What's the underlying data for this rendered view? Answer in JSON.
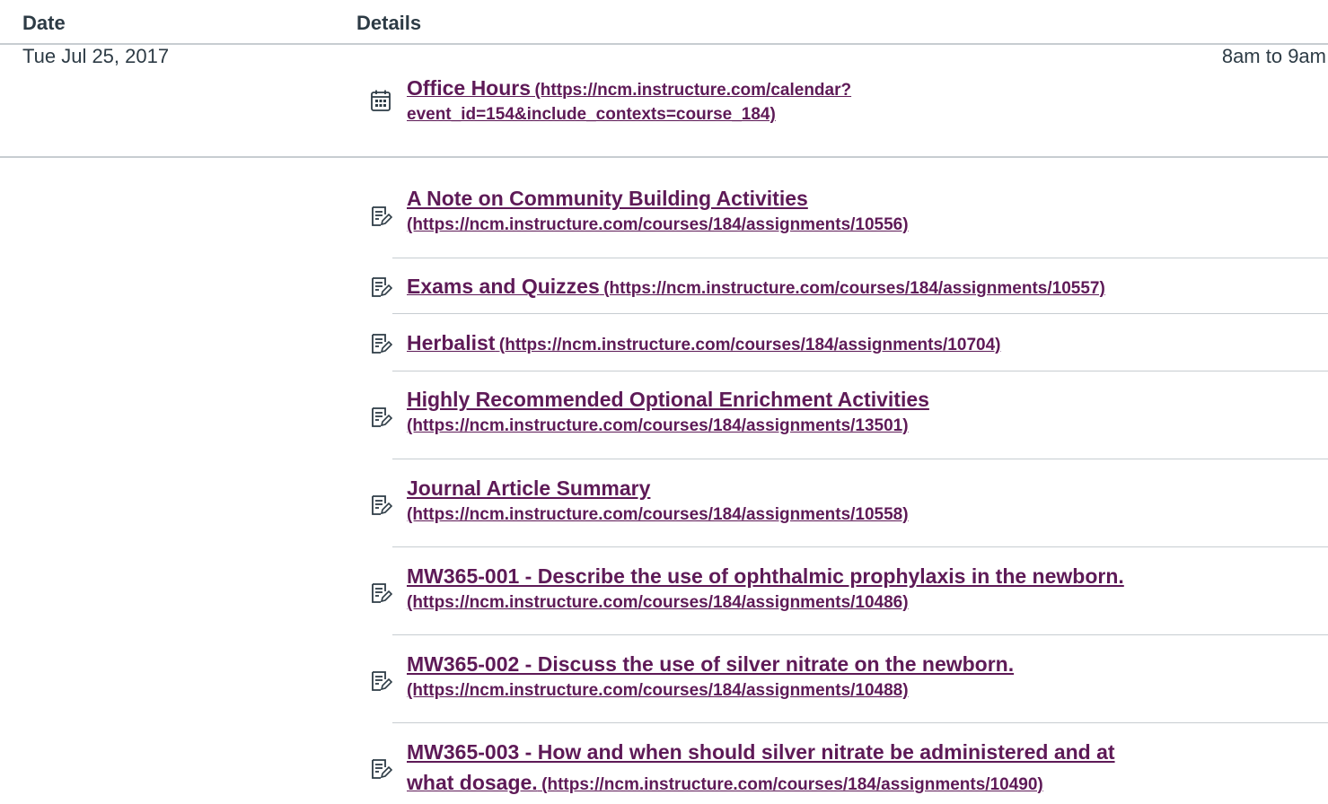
{
  "table": {
    "header_date": "Date",
    "header_details": "Details"
  },
  "event": {
    "date": "Tue Jul 25, 2017",
    "title": "Office Hours",
    "url_line1": "(https://ncm.instructure.com/calendar?",
    "url_line2": "event_id=154&include_contexts=course_184)",
    "time": "8am to 9am",
    "icon": "calendar-icon"
  },
  "assignments": [
    {
      "title": "A Note on Community Building Activities",
      "url": "(https://ncm.instructure.com/courses/184/assignments/10556)",
      "icon": "assignment-icon"
    },
    {
      "title": "Exams and Quizzes",
      "url": "(https://ncm.instructure.com/courses/184/assignments/10557)",
      "icon": "assignment-icon"
    },
    {
      "title": "Herbalist",
      "url": "(https://ncm.instructure.com/courses/184/assignments/10704)",
      "icon": "assignment-icon"
    },
    {
      "title": "Highly Recommended Optional Enrichment Activities",
      "url": "(https://ncm.instructure.com/courses/184/assignments/13501)",
      "icon": "assignment-icon"
    },
    {
      "title": "Journal Article Summary",
      "url": "(https://ncm.instructure.com/courses/184/assignments/10558)",
      "icon": "assignment-icon"
    },
    {
      "title": "MW365-001 - Describe the use of ophthalmic prophylaxis in the newborn.",
      "url": "(https://ncm.instructure.com/courses/184/assignments/10486)",
      "icon": "assignment-icon"
    },
    {
      "title": "MW365-002 - Discuss the use of silver nitrate on the newborn.",
      "url": "(https://ncm.instructure.com/courses/184/assignments/10488)",
      "icon": "assignment-icon"
    },
    {
      "title_line1": "MW365-003 - How and when should silver nitrate be administered and at",
      "title_line2": "what dosage.",
      "url": "(https://ncm.instructure.com/courses/184/assignments/10490)",
      "icon": "assignment-icon"
    }
  ],
  "colors": {
    "link": "#5e1a57",
    "text": "#2d3b45",
    "divider": "#c7cdd1"
  }
}
